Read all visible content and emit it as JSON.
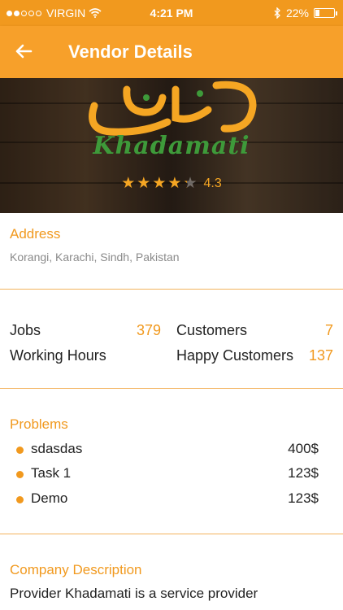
{
  "status_bar": {
    "carrier": "VIRGIN",
    "time": "4:21 PM",
    "battery": "22%",
    "battery_level": 0.22
  },
  "header": {
    "title": "Vendor Details"
  },
  "hero": {
    "brand": "Khadamati",
    "rating_value": "4.3",
    "rating": 4.3,
    "rating_max": 5
  },
  "address": {
    "label": "Address",
    "text": "Korangi, Karachi, Sindh, Pakistan"
  },
  "stats": {
    "jobs_label": "Jobs",
    "jobs_value": "379",
    "customers_label": "Customers",
    "customers_value": "7",
    "hours_label": "Working Hours",
    "happy_label": "Happy Customers",
    "happy_value": "137"
  },
  "problems": {
    "label": "Problems",
    "items": [
      {
        "name": "sdasdas",
        "price": "400$"
      },
      {
        "name": "Task 1",
        "price": "123$"
      },
      {
        "name": "Demo",
        "price": "123$"
      }
    ]
  },
  "description": {
    "label": "Company Description",
    "text": "Provider Khadamati is a service provider"
  },
  "colors": {
    "accent": "#f7a02a",
    "status": "#f1991e",
    "brand_green": "#3e9a3a"
  },
  "icons": [
    "wifi-icon",
    "bluetooth-icon",
    "battery-icon",
    "back-arrow-icon",
    "star-icon",
    "bullet-icon"
  ]
}
